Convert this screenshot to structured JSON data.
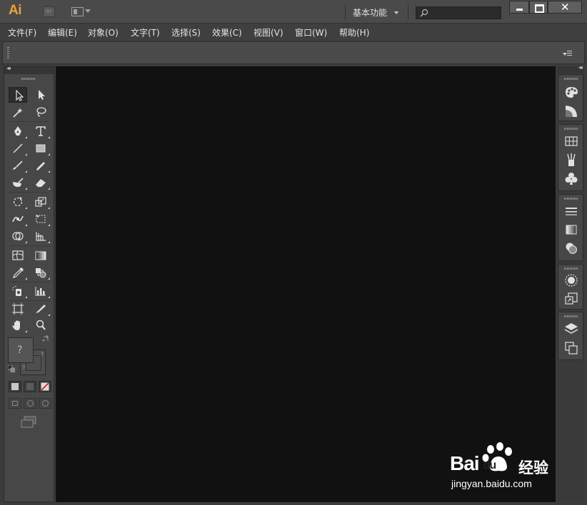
{
  "app": {
    "logo": "Ai",
    "bridge_label": "Br",
    "workspace": "基本功能",
    "search_placeholder": ""
  },
  "menu": {
    "items": [
      "文件(F)",
      "编辑(E)",
      "对象(O)",
      "文字(T)",
      "选择(S)",
      "效果(C)",
      "视图(V)",
      "窗口(W)",
      "帮助(H)"
    ]
  },
  "tools": {
    "fill_label": "?",
    "stroke_label": "?",
    "selected": "selection-tool"
  },
  "colors": {
    "accent": "#e8a33c",
    "canvas": "#111111",
    "panel": "#474747",
    "titlebar": "#4a4a4a"
  },
  "watermark": {
    "brand": "Bai",
    "brand_suffix": "du",
    "cn": "经验",
    "url": "jingyan.baidu.com"
  }
}
